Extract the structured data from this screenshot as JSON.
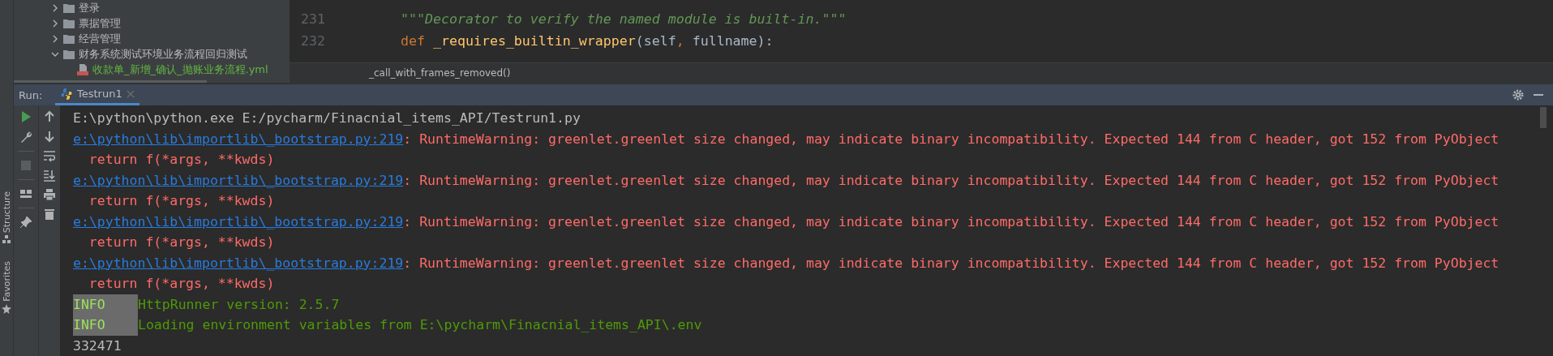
{
  "project_tree": {
    "items": [
      {
        "label": "登录",
        "kind": "folder",
        "expanded": false
      },
      {
        "label": "票据管理",
        "kind": "folder",
        "expanded": false
      },
      {
        "label": "经营管理",
        "kind": "folder",
        "expanded": false
      },
      {
        "label": "财务系统测试环境业务流程回归测试",
        "kind": "folder",
        "expanded": true,
        "children": [
          {
            "label": "收款单_新增_确认_抛账业务流程.yml",
            "kind": "yml"
          }
        ]
      }
    ]
  },
  "editor": {
    "lines": [
      {
        "number": "231",
        "tokens": [
          {
            "kind": "docstring",
            "text": "\"\"\"Decorator to verify the named module is built-in.\"\"\""
          }
        ]
      },
      {
        "number": "232",
        "tokens": [
          {
            "kind": "keyword",
            "text": "def "
          },
          {
            "kind": "function",
            "text": "_requires_builtin_wrapper"
          },
          {
            "kind": "plain",
            "text": "(self"
          },
          {
            "kind": "keyword",
            "text": ", "
          },
          {
            "kind": "plain",
            "text": "fullname):"
          }
        ]
      }
    ],
    "breadcrumb": "_call_with_frames_removed()"
  },
  "side_stripe": [
    {
      "label": "Structure",
      "kind": "structure"
    },
    {
      "label": "Favorites",
      "kind": "favorites"
    }
  ],
  "run_panel": {
    "label": "Run:",
    "tabs": [
      {
        "label": "Testrun1",
        "selected": true
      }
    ],
    "console": [
      {
        "kind": "plain",
        "text": "E:\\python\\python.exe E:/pycharm/Finacnial_items_API/Testrun1.py"
      },
      {
        "kind": "warning",
        "link": "e:\\python\\lib\\importlib\\_bootstrap.py:219",
        "text": ": RuntimeWarning: greenlet.greenlet size changed, may indicate binary incompatibility. Expected 144 from C header, got 152 from PyObject"
      },
      {
        "kind": "error",
        "text": "  return f(*args, **kwds)"
      },
      {
        "kind": "warning",
        "link": "e:\\python\\lib\\importlib\\_bootstrap.py:219",
        "text": ": RuntimeWarning: greenlet.greenlet size changed, may indicate binary incompatibility. Expected 144 from C header, got 152 from PyObject"
      },
      {
        "kind": "error",
        "text": "  return f(*args, **kwds)"
      },
      {
        "kind": "warning",
        "link": "e:\\python\\lib\\importlib\\_bootstrap.py:219",
        "text": ": RuntimeWarning: greenlet.greenlet size changed, may indicate binary incompatibility. Expected 144 from C header, got 152 from PyObject"
      },
      {
        "kind": "error",
        "text": "  return f(*args, **kwds)"
      },
      {
        "kind": "warning",
        "link": "e:\\python\\lib\\importlib\\_bootstrap.py:219",
        "text": ": RuntimeWarning: greenlet.greenlet size changed, may indicate binary incompatibility. Expected 144 from C header, got 152 from PyObject"
      },
      {
        "kind": "error",
        "text": "  return f(*args, **kwds)"
      },
      {
        "kind": "info",
        "tag": "INFO",
        "text": "HttpRunner version: 2.5.7"
      },
      {
        "kind": "info",
        "tag": "INFO",
        "text": "Loading environment variables from E:\\pycharm\\Finacnial_items_API\\.env"
      },
      {
        "kind": "plain",
        "text": "332471"
      }
    ]
  }
}
